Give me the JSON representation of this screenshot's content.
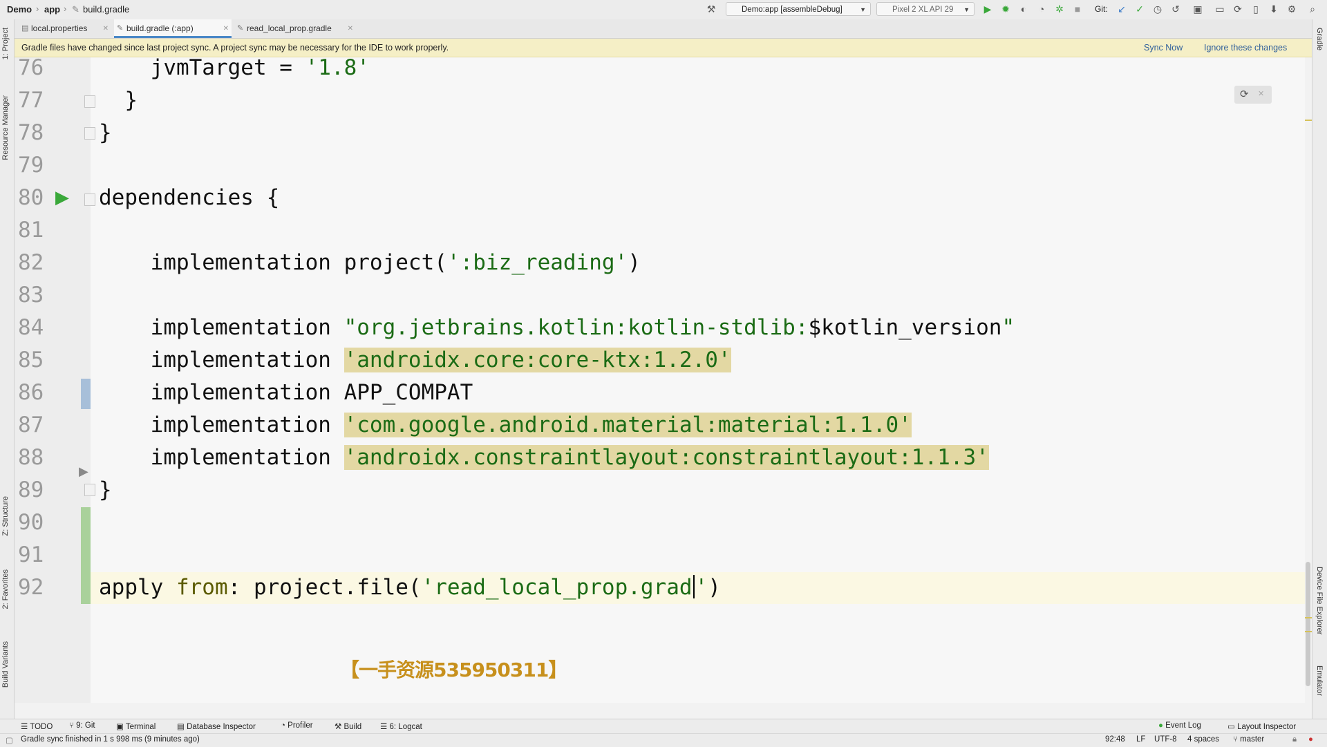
{
  "breadcrumb": {
    "project": "Demo",
    "module": "app",
    "file": "build.gradle"
  },
  "toolbar": {
    "run_config": "Demo:app [assembleDebug]",
    "device": "Pixel 2 XL API 29",
    "git_label": "Git:"
  },
  "tabs": [
    {
      "label": "local.properties",
      "active": false
    },
    {
      "label": "build.gradle (:app)",
      "active": true
    },
    {
      "label": "read_local_prop.gradle",
      "active": false
    }
  ],
  "notification": {
    "message": "Gradle files have changed since last project sync. A project sync may be necessary for the IDE to work properly.",
    "sync_now": "Sync Now",
    "ignore": "Ignore these changes"
  },
  "left_tools": {
    "project": "1: Project",
    "resource_manager": "Resource Manager",
    "structure": "Z: Structure",
    "favorites": "2: Favorites",
    "build_variants": "Build Variants"
  },
  "right_tools": {
    "gradle": "Gradle",
    "device_file_explorer": "Device File Explorer",
    "emulator": "Emulator"
  },
  "code": {
    "lines": [
      "76",
      "77",
      "78",
      "79",
      "80",
      "81",
      "82",
      "83",
      "84",
      "85",
      "86",
      "87",
      "88",
      "89",
      "90",
      "91",
      "92"
    ],
    "l76": "    jvmTarget = ",
    "l76_str": "'1.8'",
    "l77": "  }",
    "l78": "}",
    "l80": "dependencies {",
    "l82": "    implementation project(",
    "l82_str": "':biz_reading'",
    "l82_end": ")",
    "impl": "    implementation ",
    "l84_str": "\"org.jetbrains.kotlin:kotlin-stdlib:",
    "l84_var": "$kotlin_version",
    "l84_end": "\"",
    "l85_str": "'androidx.core:core-ktx:1.2.0'",
    "l86_rest": "APP_COMPAT",
    "l87_str": "'com.google.android.material:material:1.1.0'",
    "l88_str": "'androidx.constraintlayout:constraintlayout:1.1.3'",
    "l89": "}",
    "l92_a": "apply ",
    "l92_from": "from",
    "l92_b": ": project.file(",
    "l92_str1": "'read_local_prop.grad",
    "l92_str2": "'",
    "l92_end": ")"
  },
  "watermark": "【一手资源535950311】",
  "bottom_tools": [
    "TODO",
    "9: Git",
    "Terminal",
    "Database Inspector",
    "Profiler",
    "Build",
    "6: Logcat"
  ],
  "bottom_right_tools": {
    "event_log": "Event Log",
    "layout_inspector": "Layout Inspector"
  },
  "status": {
    "message": "Gradle sync finished in 1 s 998 ms (9 minutes ago)",
    "position": "92:48",
    "line_sep": "LF",
    "encoding": "UTF-8",
    "indent": "4 spaces",
    "branch": "master"
  },
  "colors": {
    "string": "#1b6b15",
    "highlight": "#e3d8a3",
    "notification": "#f5efc6"
  }
}
